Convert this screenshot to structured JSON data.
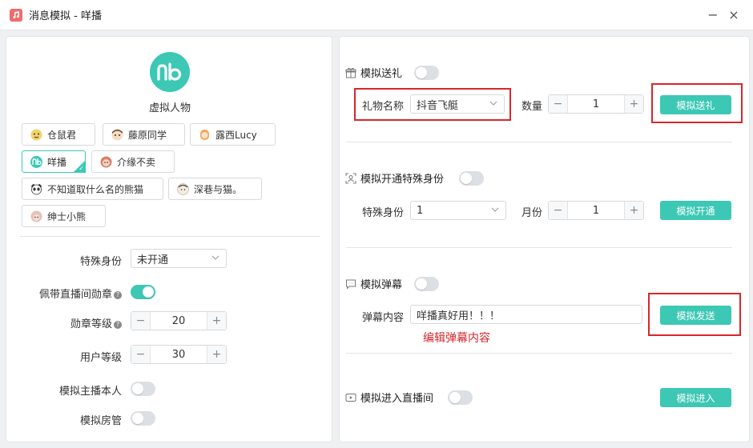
{
  "window": {
    "title": "消息模拟 - 咩播",
    "minimize": "−",
    "close": "×"
  },
  "left": {
    "avatar_label": "虚拟人物",
    "users": [
      {
        "name": "仓鼠君",
        "face_color": "#f3d36a"
      },
      {
        "name": "藤原同学",
        "face_color": "#e8b58e"
      },
      {
        "name": "露西Lucy",
        "face_color": "#f0a85a"
      },
      {
        "name": "咩播",
        "face_color": "#3cc8b4"
      },
      {
        "name": "介缘不卖",
        "face_color": "#d9826a"
      },
      {
        "name": "不知道取什么名的熊猫",
        "face_color": "#555555"
      },
      {
        "name": "深巷与猫。",
        "face_color": "#c9b79a"
      },
      {
        "name": "绅士小熊",
        "face_color": "#c79a8a"
      }
    ],
    "special_identity": {
      "label": "特殊身份",
      "value": "未开通"
    },
    "wear_badge": {
      "label": "佩带直播间勋章",
      "help": "?",
      "on": true
    },
    "badge_level": {
      "label": "勋章等级",
      "help": "?",
      "value": "20",
      "minus": "−",
      "plus": "+"
    },
    "user_level": {
      "label": "用户等级",
      "value": "30",
      "minus": "−",
      "plus": "+"
    },
    "simulate_host": {
      "label": "模拟主播本人",
      "on": false
    },
    "simulate_admin": {
      "label": "模拟房管",
      "on": false
    }
  },
  "right": {
    "gift": {
      "title": "模拟送礼",
      "on": false,
      "name_label": "礼物名称",
      "name_value": "抖音飞艇",
      "qty_label": "数量",
      "qty_value": "1",
      "minus": "−",
      "plus": "+",
      "button": "模拟送礼"
    },
    "identity": {
      "title": "模拟开通特殊身份",
      "on": false,
      "identity_label": "特殊身份",
      "identity_value": "1",
      "month_label": "月份",
      "month_value": "1",
      "minus": "−",
      "plus": "+",
      "button": "模拟开通"
    },
    "danmaku": {
      "title": "模拟弹幕",
      "on": false,
      "content_label": "弹幕内容",
      "content_value": "咩播真好用！！！",
      "button": "模拟发送",
      "annotation": "编辑弹幕内容"
    },
    "enter": {
      "title": "模拟进入直播间",
      "on": false,
      "button": "模拟进入"
    }
  },
  "colors": {
    "accent": "#3cc8b4",
    "highlight": "#d9262c"
  }
}
